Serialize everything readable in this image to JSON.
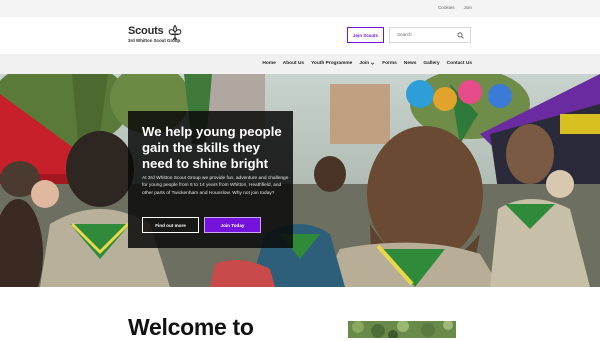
{
  "utility": {
    "links": [
      "Cookies",
      "Join"
    ]
  },
  "brand": {
    "name": "Scouts",
    "group": "3rd Whitton Scout Group",
    "logo": "fleur-de-lis-icon"
  },
  "header": {
    "join_label": "Join Scouts",
    "search_placeholder": "Search"
  },
  "nav": {
    "items": [
      "Home",
      "About Us",
      "Youth Programme",
      "Join",
      "Forms",
      "News",
      "Gallery",
      "Contact Us"
    ],
    "dropdown_item": "Join"
  },
  "hero": {
    "headline": "We help young people gain the skills they need to shine bright",
    "body": "At 3rd Whitton Scout Group we provide fun, adventure and challenge for young people from 6 to 14 years from Whitton, Heathfield, and other parts of Twickenham and Hounslow. Why not join today?",
    "find_out_label": "Find out more",
    "join_today_label": "Join Today"
  },
  "welcome": {
    "heading": "Welcome to"
  },
  "colors": {
    "brand_purple": "#7413dc",
    "card_bg": "#0a0a0a",
    "neckerchief_green": "#2f8a3a"
  }
}
